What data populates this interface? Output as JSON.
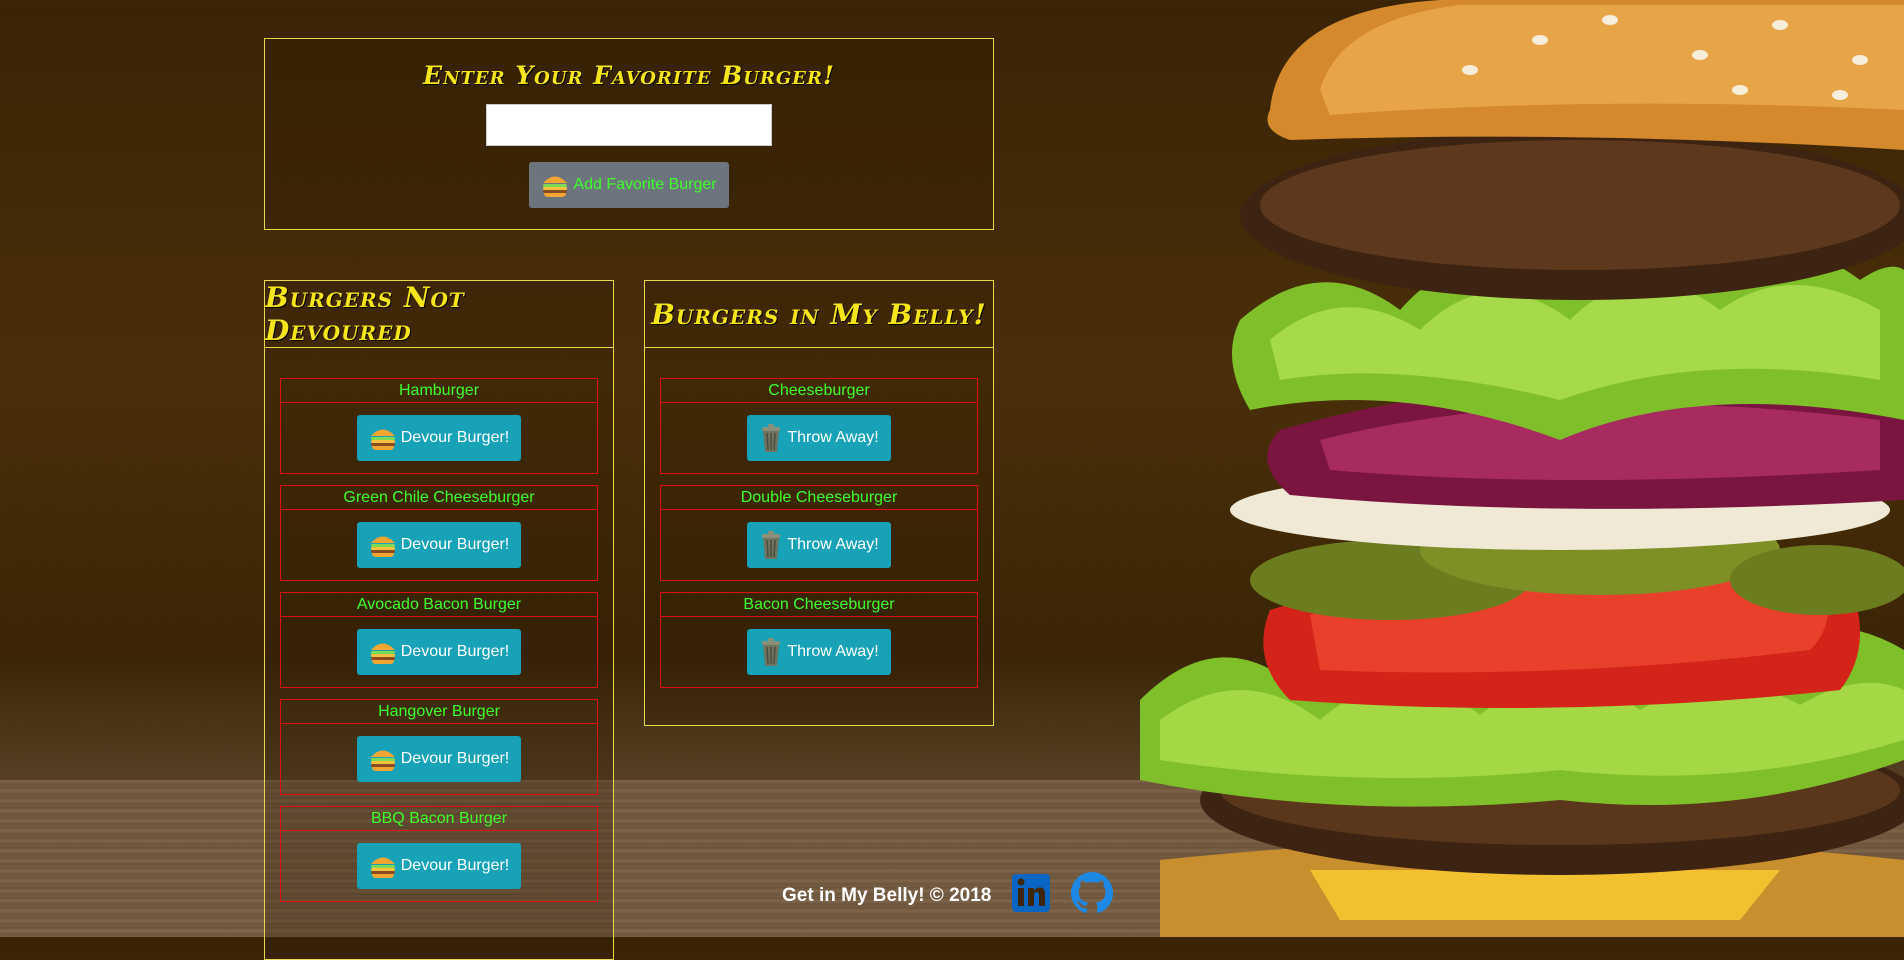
{
  "form": {
    "title": "Enter Your Favorite Burger!",
    "input_value": "",
    "add_button_label": "Add Favorite Burger"
  },
  "not_devoured": {
    "title": "Burgers Not Devoured",
    "items": [
      {
        "name": "Hamburger",
        "button": "Devour Burger!"
      },
      {
        "name": "Green Chile Cheeseburger",
        "button": "Devour Burger!"
      },
      {
        "name": "Avocado Bacon Burger",
        "button": "Devour Burger!"
      },
      {
        "name": "Hangover Burger",
        "button": "Devour Burger!"
      },
      {
        "name": "BBQ Bacon Burger",
        "button": "Devour Burger!"
      }
    ]
  },
  "devoured": {
    "title": "Burgers in My Belly!",
    "items": [
      {
        "name": "Cheeseburger",
        "button": "Throw Away!"
      },
      {
        "name": "Double Cheeseburger",
        "button": "Throw Away!"
      },
      {
        "name": "Bacon Cheeseburger",
        "button": "Throw Away!"
      }
    ]
  },
  "footer": {
    "text": "Get in My Belly! © 2018",
    "icons": [
      "linkedin-icon",
      "github-icon"
    ]
  },
  "colors": {
    "title_yellow": "#f5e51a",
    "item_green": "#3dff29",
    "panel_border": "#e8d84a",
    "item_border": "#e01010",
    "devour_button": "#17a2b8",
    "add_button": "#6c757d",
    "linkedin_blue": "#0a66c2",
    "github_blue": "#1e88e5"
  }
}
